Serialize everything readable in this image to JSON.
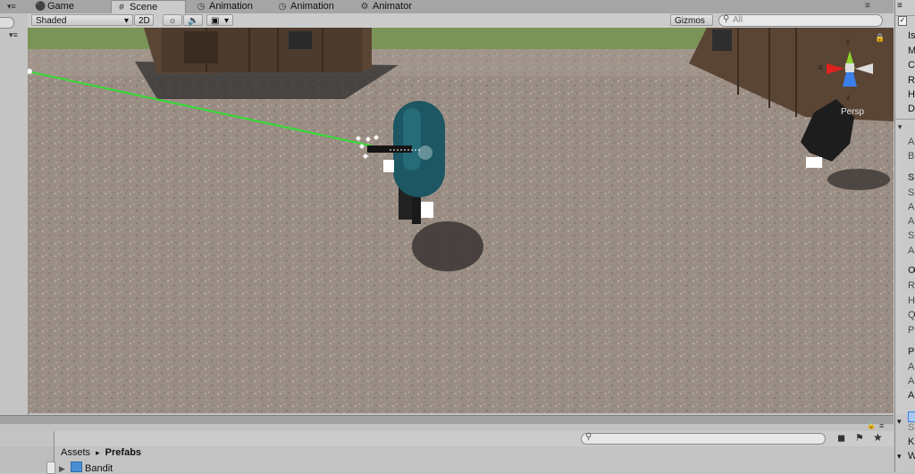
{
  "tabs": [
    {
      "label": "Game",
      "icon": "game-icon"
    },
    {
      "label": "Scene",
      "icon": "scene-icon",
      "active": true
    },
    {
      "label": "Animation",
      "icon": "animation-icon"
    },
    {
      "label": "Animation",
      "icon": "animation-icon"
    },
    {
      "label": "Animator",
      "icon": "animator-icon"
    }
  ],
  "toolbar": {
    "shading_mode": "Shaded",
    "mode_2d": "2D",
    "gizmos_label": "Gizmos",
    "search_placeholder": "All"
  },
  "scene": {
    "projection_label": "Persp",
    "axis_x": "x",
    "axis_y": "y",
    "axis_z": "z",
    "axis_colors": {
      "x": "#e0221d",
      "y": "#8fd32a",
      "z": "#3b7fe9"
    }
  },
  "inspector_letters": [
    "Is",
    "M",
    "C",
    "R",
    "H",
    "D",
    "",
    "A",
    "B",
    "S",
    "S",
    "A",
    "A",
    "S",
    "A",
    "O",
    "R",
    "H",
    "Q",
    "P",
    "P",
    "A",
    "A",
    "A"
  ],
  "project": {
    "breadcrumb_root": "Assets",
    "breadcrumb_sep": "▸",
    "breadcrumb_current": "Prefabs",
    "items": [
      {
        "label": "Bandit",
        "icon": "prefab-icon"
      }
    ]
  },
  "bottom_right_letters": [
    "S",
    "K",
    "W"
  ]
}
